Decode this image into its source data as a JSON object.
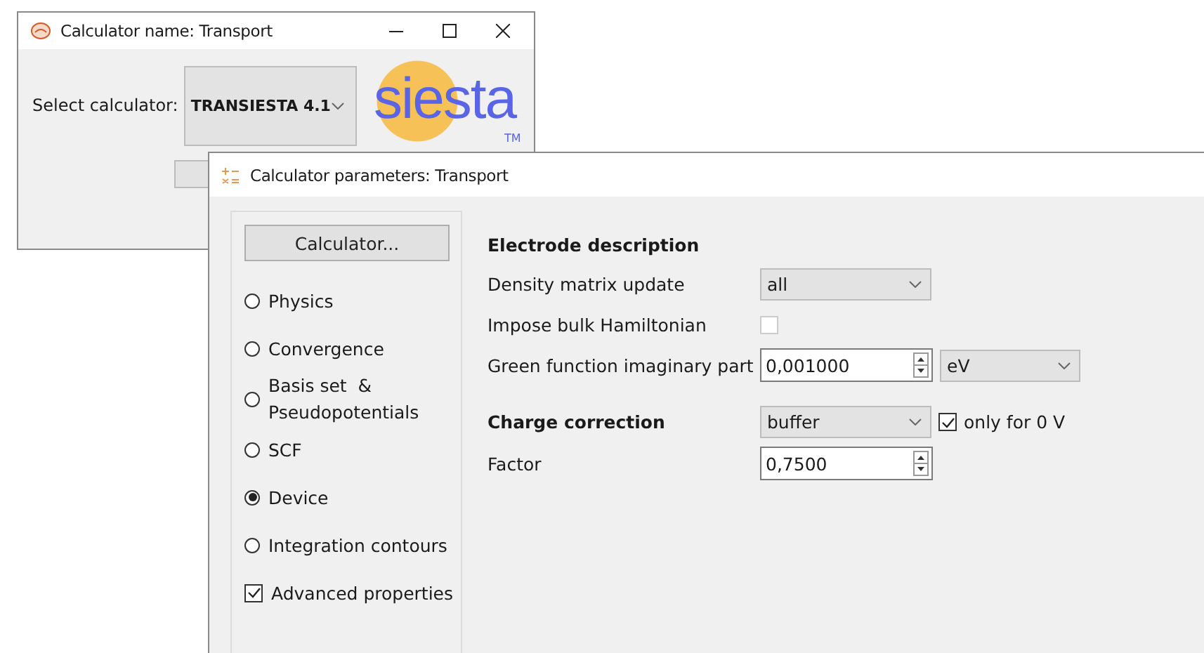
{
  "back_window": {
    "title": "Calculator name: Transport",
    "select_label": "Select calculator:",
    "calculator": "TRANSIESTA 4.1",
    "logo": {
      "text": "siesta",
      "mark": "TM"
    }
  },
  "front_window": {
    "title": "Calculator parameters: Transport",
    "sidebar": {
      "button": "Calculator...",
      "items": [
        {
          "kind": "radio",
          "label": "Physics",
          "selected": false
        },
        {
          "kind": "radio",
          "label": "Convergence",
          "selected": false
        },
        {
          "kind": "radio",
          "label": "Basis set  &\nPseudopotentials",
          "selected": false
        },
        {
          "kind": "radio",
          "label": "SCF",
          "selected": false
        },
        {
          "kind": "radio",
          "label": "Device",
          "selected": true
        },
        {
          "kind": "radio",
          "label": "Integration contours",
          "selected": false
        },
        {
          "kind": "checkbox",
          "label": "Advanced properties",
          "checked": true
        }
      ]
    },
    "sections": [
      {
        "heading": "Electrode description",
        "rows": [
          {
            "kind": "combo",
            "label": "Density matrix update",
            "value": "all"
          },
          {
            "kind": "checkbox",
            "label": "Impose bulk Hamiltonian",
            "checked": false
          },
          {
            "kind": "spin-combo",
            "label": "Green function imaginary part",
            "value": "0,001000",
            "unit": "eV"
          }
        ]
      },
      {
        "heading": "Charge correction",
        "heading_value": "buffer",
        "heading_check": {
          "label": "only for 0 V",
          "checked": true
        },
        "rows": [
          {
            "kind": "spin",
            "label": "Factor",
            "value": "0,7500"
          }
        ]
      }
    ]
  }
}
